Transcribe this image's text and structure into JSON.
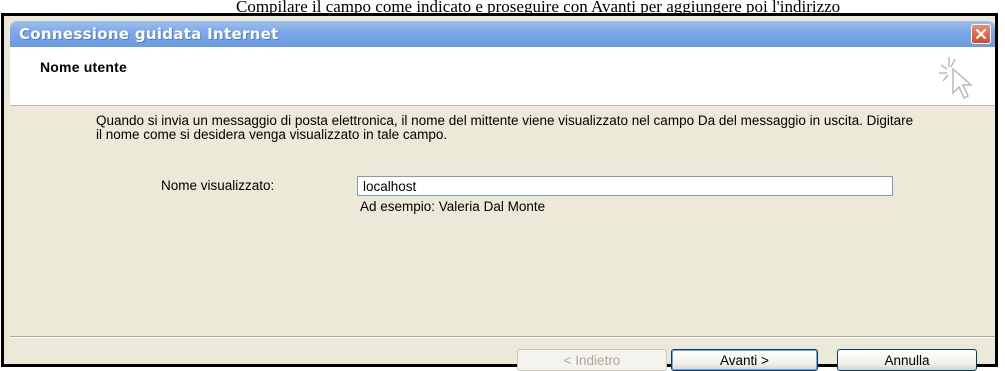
{
  "caption": "Compilare il campo come indicato e proseguire con Avanti per aggiungere poi l'indirizzo",
  "window": {
    "title": "Connessione guidata Internet"
  },
  "header": {
    "title": "Nome utente"
  },
  "body": {
    "description": "Quando si invia un messaggio di posta elettronica, il nome del mittente viene visualizzato nel campo Da del messaggio in uscita. Digitare il nome come si desidera venga visualizzato in tale campo.",
    "field_label": "Nome visualizzato:",
    "field_value": "localhost",
    "example": "Ad esempio: Valeria Dal Monte"
  },
  "buttons": {
    "back": "< Indietro",
    "next": "Avanti >",
    "cancel": "Annulla"
  },
  "colors": {
    "titlebar": "#7aa7e8",
    "dialog_bg": "#ece9d8",
    "close_button": "#d8492b"
  },
  "icons": {
    "close": "close-x-icon",
    "wizard": "cursor-sparkle-icon"
  }
}
